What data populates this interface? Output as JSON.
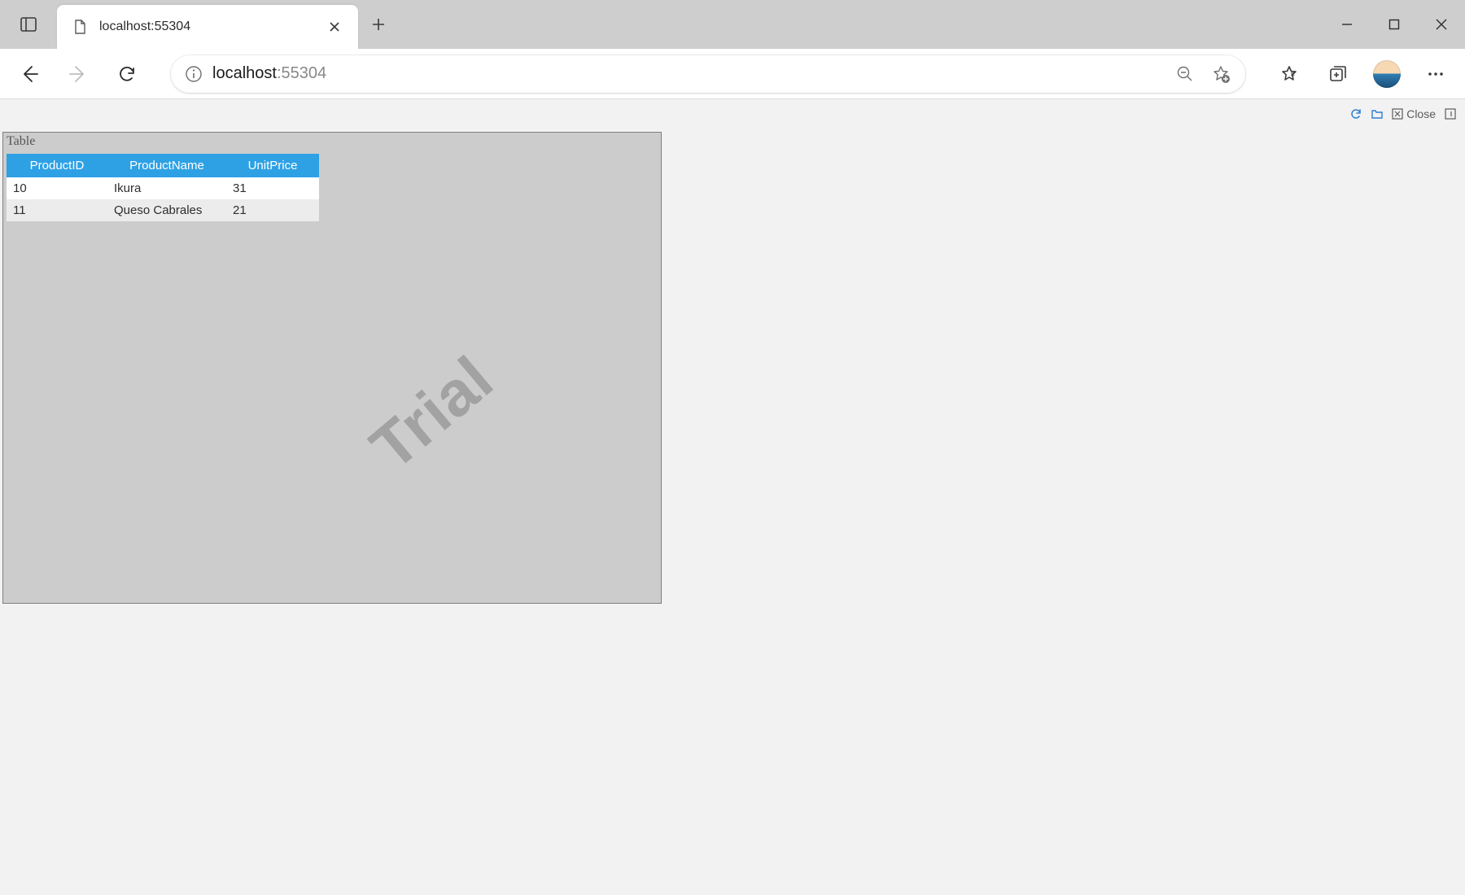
{
  "window": {
    "tab_title": "localhost:55304",
    "url_host": "localhost",
    "url_port": ":55304",
    "dev_strip": {
      "close_label": "Close"
    }
  },
  "report": {
    "title": "Table",
    "watermark": "Trial",
    "columns": [
      "ProductID",
      "ProductName",
      "UnitPrice"
    ],
    "rows": [
      {
        "ProductID": "10",
        "ProductName": "Ikura",
        "UnitPrice": "31"
      },
      {
        "ProductID": "11",
        "ProductName": "Queso Cabrales",
        "UnitPrice": "21"
      }
    ]
  }
}
